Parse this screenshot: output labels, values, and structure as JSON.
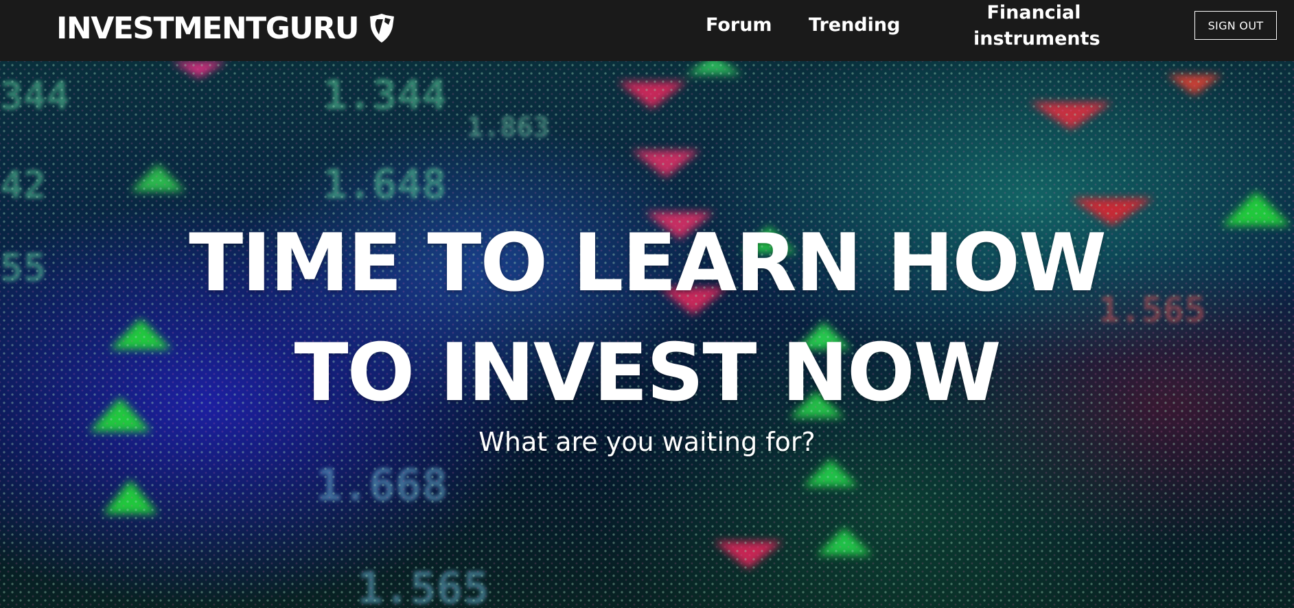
{
  "navbar": {
    "brand": "INVESTMENTGURU",
    "links": [
      {
        "label": "Forum"
      },
      {
        "label": "Trending"
      },
      {
        "label": "Financial instruments",
        "line1": "Financial",
        "line2": "instruments"
      }
    ],
    "sign_out_label": "SIGN OUT",
    "background_color": "#1a1a1a",
    "logo_icon": "shield-emblem-icon"
  },
  "hero": {
    "headline_line1": "TIME TO LEARN HOW",
    "headline_line2": "TO INVEST NOW",
    "subheadline": "What are you waiting for?",
    "background": "stock-ticker-led-board"
  }
}
